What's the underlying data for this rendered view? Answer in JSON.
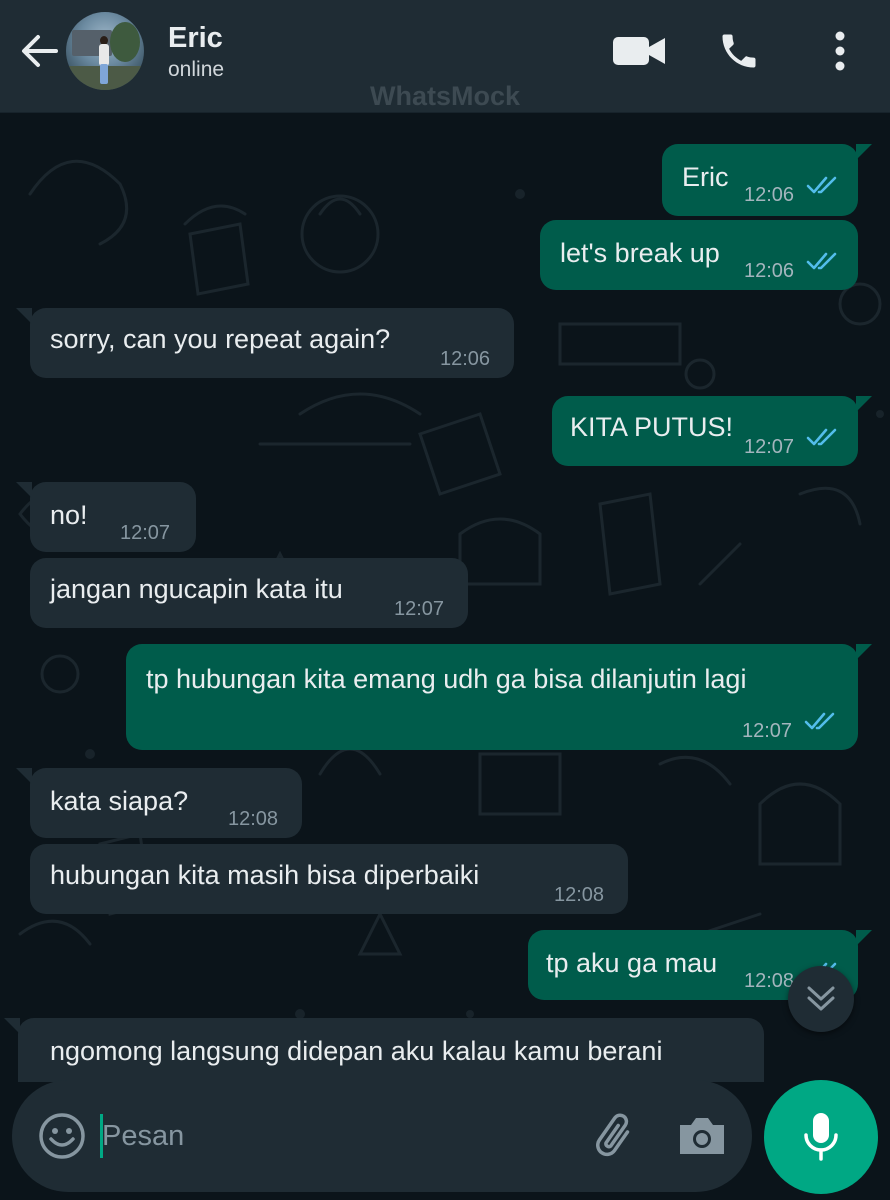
{
  "header": {
    "contact_name": "Eric",
    "contact_status": "online",
    "watermark": "WhatsMock"
  },
  "messages": [
    {
      "direction": "out",
      "text": "Eric",
      "time": "12:06",
      "read": true
    },
    {
      "direction": "out",
      "text": "let's break up",
      "time": "12:06",
      "read": true
    },
    {
      "direction": "in",
      "text": "sorry, can you repeat again?",
      "time": "12:06"
    },
    {
      "direction": "out",
      "text": "KITA PUTUS!",
      "time": "12:07",
      "read": true
    },
    {
      "direction": "in",
      "text": "no!",
      "time": "12:07"
    },
    {
      "direction": "in",
      "text": "jangan ngucapin kata itu",
      "time": "12:07"
    },
    {
      "direction": "out",
      "text": "tp hubungan kita emang udh ga bisa dilanjutin lagi",
      "time": "12:07",
      "read": true
    },
    {
      "direction": "in",
      "text": "kata siapa?",
      "time": "12:08"
    },
    {
      "direction": "in",
      "text": "hubungan kita masih bisa diperbaiki",
      "time": "12:08"
    },
    {
      "direction": "out",
      "text": "tp aku ga mau",
      "time": "12:08",
      "read": true
    },
    {
      "direction": "in",
      "text": "ngomong langsung didepan aku kalau kamu berani",
      "time": ""
    }
  ],
  "composer": {
    "placeholder": "Pesan",
    "value": ""
  },
  "icons": {
    "back": "arrow-left",
    "video_call": "videocam",
    "voice_call": "phone",
    "menu": "more-vert",
    "emoji": "smiley",
    "attach": "paperclip",
    "camera": "camera",
    "mic": "microphone",
    "scroll_down": "double-chevron-down",
    "read_receipt": "double-check"
  },
  "colors": {
    "header_bg": "#1f2c34",
    "chat_bg": "#0b141a",
    "outgoing_bubble": "#005c4b",
    "incoming_bubble": "#1f2c34",
    "accent": "#00a884",
    "read_tick": "#53bdeb"
  }
}
